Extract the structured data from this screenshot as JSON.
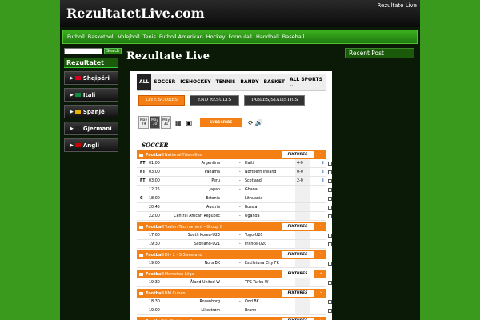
{
  "site": {
    "title": "RezultatetLive.com",
    "header_link": "Rezultate Live"
  },
  "nav": [
    "Futboll",
    "Basketboll",
    "Volejboll",
    "Tenis",
    "Futboll Amerikan",
    "Hockey",
    "Formula1",
    "Handball",
    "Baseball"
  ],
  "search": {
    "button": "Search"
  },
  "left_title": "Rezultatet",
  "countries": [
    {
      "name": "Shqipëri",
      "flag": "#d4001e"
    },
    {
      "name": "Itali",
      "flag": "#0d8c3c"
    },
    {
      "name": "Spanjë",
      "flag": "#e8b100"
    },
    {
      "name": "Gjermani",
      "flag": "#222222"
    },
    {
      "name": "Angli",
      "flag": "#cc0000"
    }
  ],
  "main_title": "Rezultate Live",
  "right_title": "Recent Post",
  "sport_tabs": [
    "ALL",
    "SOCCER",
    "ICEHOCKEY",
    "TENNIS",
    "BANDY",
    "BASKET",
    "ALL SPORTS ⌄"
  ],
  "sub_tabs": [
    "LIVE SCORES",
    "END RESULTS",
    "TABLES/STATISTICS"
  ],
  "dates": [
    {
      "month": "May",
      "day": "29"
    },
    {
      "month": "May",
      "day": "30"
    },
    {
      "month": "May",
      "day": "31"
    }
  ],
  "subscribe_label": "SUBSCRIBE",
  "section": "SOCCER",
  "fixtures_label": "FIXTURES",
  "accent": "#f47f14",
  "leagues": [
    {
      "sport": "Football",
      "name": "National Friendlies",
      "matches": [
        {
          "status": "FT",
          "time": "01:00",
          "home": "Argentina",
          "away": "Haiti",
          "score": "4-0",
          "info": "i"
        },
        {
          "status": "FT",
          "time": "03:00",
          "home": "Panama",
          "away": "Northern Ireland",
          "score": "0-0",
          "info": "i"
        },
        {
          "status": "FT",
          "time": "03:00",
          "home": "Peru",
          "away": "Scotland",
          "score": "2-0",
          "info": "i"
        },
        {
          "status": "",
          "time": "12:25",
          "home": "Japan",
          "away": "Ghana",
          "score": "",
          "info": ""
        },
        {
          "status": "C",
          "time": "18:00",
          "home": "Estonia",
          "away": "Lithuania",
          "score": "",
          "info": ""
        },
        {
          "status": "",
          "time": "20:45",
          "home": "Austria",
          "away": "Russia",
          "score": "",
          "info": ""
        },
        {
          "status": "",
          "time": "22:00",
          "home": "Central African Republic",
          "away": "Uganda",
          "score": "",
          "info": ""
        }
      ]
    },
    {
      "sport": "Football",
      "name": "Toulon Tournament - Group B",
      "matches": [
        {
          "status": "",
          "time": "17:00",
          "home": "South Korea-U23",
          "away": "Togo-U20",
          "score": "",
          "info": ""
        },
        {
          "status": "",
          "time": "19:30",
          "home": "Scotland-U21",
          "away": "France-U20",
          "score": "",
          "info": ""
        }
      ]
    },
    {
      "sport": "Football",
      "name": "Div 2 - S.Sweeland",
      "matches": [
        {
          "status": "",
          "time": "19:00",
          "home": "Nora BK",
          "away": "Eskilstuna City FK",
          "score": "",
          "info": ""
        }
      ]
    },
    {
      "sport": "Football",
      "name": "Marseten Liiga",
      "matches": [
        {
          "status": "",
          "time": "19:30",
          "home": "Åland United W",
          "away": "TPS Turku W",
          "score": "",
          "info": ""
        }
      ]
    },
    {
      "sport": "Football",
      "name": "NM Cupen",
      "matches": [
        {
          "status": "",
          "time": "18:30",
          "home": "Rosenborg",
          "away": "Odd BK",
          "score": "",
          "info": ""
        },
        {
          "status": "",
          "time": "19:00",
          "home": "Lillestrøm",
          "away": "Brann",
          "score": "",
          "info": ""
        }
      ]
    },
    {
      "sport": "Football",
      "name": "2. Division - 2",
      "matches": [
        {
          "status": "",
          "time": "19:00",
          "home": "Bærum",
          "away": "Fram Larvik",
          "score": "",
          "info": ""
        }
      ]
    }
  ]
}
